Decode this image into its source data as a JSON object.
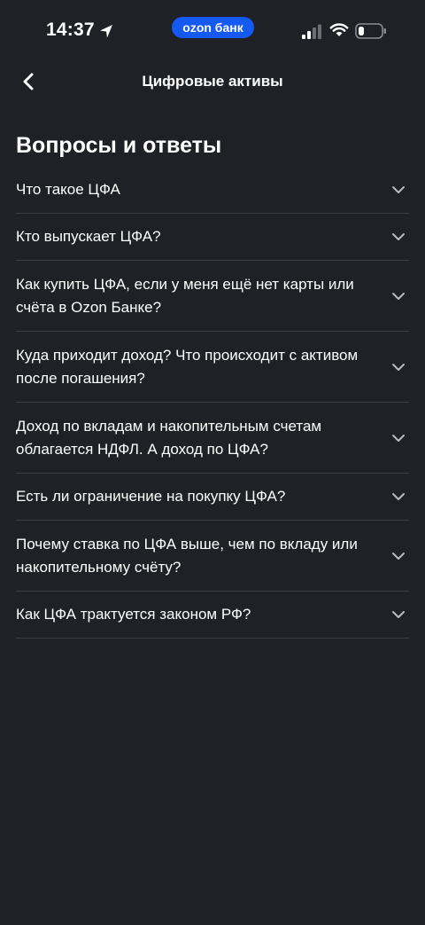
{
  "status_bar": {
    "time": "14:37",
    "brand": "ozon банк",
    "brand_color": "#1459f0",
    "icons": [
      "location-arrow-icon",
      "signal-icon",
      "wifi-icon",
      "battery-icon"
    ]
  },
  "nav": {
    "title": "Цифровые активы",
    "back_icon": "chevron-left-icon"
  },
  "section": {
    "title": "Вопросы и ответы"
  },
  "faq": [
    {
      "question": "Что такое ЦФА"
    },
    {
      "question": "Кто выпускает ЦФА?"
    },
    {
      "question": "Как купить ЦФА, если у меня ещё нет карты или счёта в Ozon Банке?"
    },
    {
      "question": "Куда приходит доход? Что происходит с активом после погашения?"
    },
    {
      "question": "Доход по вкладам и накопительным счетам облагается НДФЛ. А доход по ЦФА?"
    },
    {
      "question": "Есть ли ограничение на покупку ЦФА?"
    },
    {
      "question": "Почему ставка по ЦФА выше, чем по вкладу или накопительному счёту?"
    },
    {
      "question": "Как ЦФА трактуется законом РФ?"
    }
  ],
  "colors": {
    "background": "#1f2127",
    "divider": "#3a3d44",
    "chevron": "#b9bcc3"
  }
}
